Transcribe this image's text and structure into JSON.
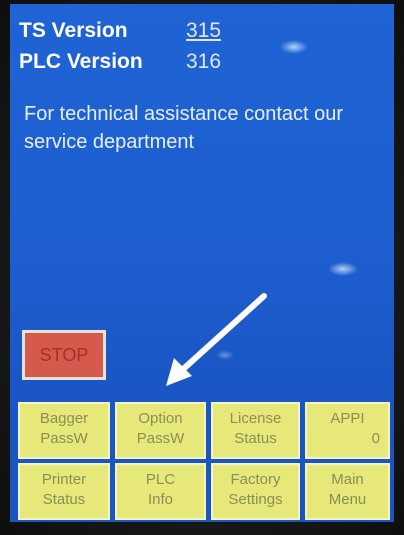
{
  "info": {
    "ts_label": "TS Version",
    "ts_value": "315",
    "plc_label": "PLC Version",
    "plc_value": "316",
    "help_text": "For technical assistance contact our service department"
  },
  "stop_button": {
    "label": "STOP"
  },
  "buttons": [
    {
      "line1": "Bagger",
      "line2": "PassW"
    },
    {
      "line1": "Option",
      "line2": "PassW"
    },
    {
      "line1": "License",
      "line2": "Status"
    },
    {
      "line1": "APPI",
      "line2": "0"
    },
    {
      "line1": "Printer",
      "line2": "Status"
    },
    {
      "line1": "PLC",
      "line2": "Info"
    },
    {
      "line1": "Factory",
      "line2": "Settings"
    },
    {
      "line1": "Main",
      "line2": "Menu"
    }
  ],
  "colors": {
    "screen": "#1e5fd0",
    "stop": "#d35a4c",
    "button": "#e7e87a",
    "arrow": "#ffffff"
  }
}
